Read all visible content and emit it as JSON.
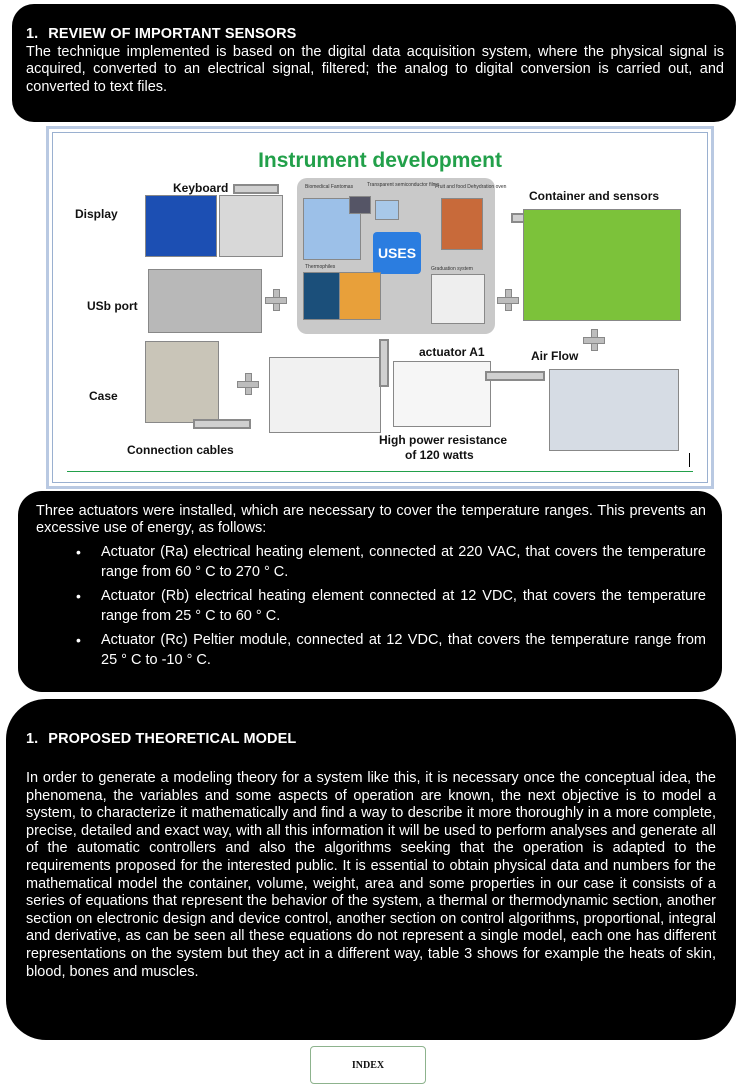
{
  "section1": {
    "number": "1.",
    "title": "REVIEW OF IMPORTANT SENSORS",
    "text": "The technique implemented is based on the digital data acquisition system, where the physical signal is acquired, converted to an electrical signal, filtered; the analog to digital conversion is carried out, and converted to text files."
  },
  "figure": {
    "title": "Instrument development",
    "labels": {
      "keyboard": "Keyboard",
      "display": "Display",
      "usb": "USb port",
      "case": "Case",
      "cables": "Connection cables",
      "container": "Container and sensors",
      "airflow": "Air Flow",
      "actuator": "actuator A1",
      "resistance1": "High power resistance",
      "resistance2": "of 120 watts",
      "uses": "USES"
    },
    "small_labels": {
      "biomedical": "Biomedical Fantomas",
      "transparent": "Transparent semiconductor films",
      "fruit": "Fruit and food Dehydration oven",
      "thermophiles": "Thermophiles",
      "graduation": "Graduation system"
    }
  },
  "section2": {
    "intro": "Three actuators were installed, which are necessary to cover the temperature ranges. This prevents an excessive use of energy, as follows:",
    "items": [
      "Actuator (Ra) electrical heating element, connected at 220 VAC, that covers the temperature range from 60 ° C to 270 ° C.",
      "Actuator (Rb) electrical heating element connected at 12 VDC, that covers the temperature range from 25 ° C to 60 ° C.",
      "Actuator (Rc) Peltier module, connected at 12 VDC, that covers the temperature range from 25 ° C to -10 ° C."
    ]
  },
  "section3": {
    "number": "1.",
    "title": "PROPOSED THEORETICAL MODEL",
    "text": "In order to generate a modeling theory for a system like this, it is necessary once the conceptual idea, the phenomena, the variables and some aspects of operation are known, the next objective is to model a system, to characterize it mathematically and find a way to describe it more thoroughly in a more complete, precise, detailed and exact way, with all this information it will be used to perform analyses and generate all of the automatic controllers and also the algorithms seeking that the operation is adapted to the requirements proposed for the interested public. It is essential to obtain physical data and numbers for the mathematical model the container, volume, weight, area and some properties in our case it consists of a series of equations that represent the behavior of the system, a thermal or thermodynamic section, another section on electronic design and device control, another section on control algorithms, proportional, integral and derivative, as can be seen all these equations do not represent a single model, each one has different representations on the system but they act in a different way, table 3 shows for example the heats of skin, blood, bones and muscles."
  },
  "index_button": "INDEX"
}
